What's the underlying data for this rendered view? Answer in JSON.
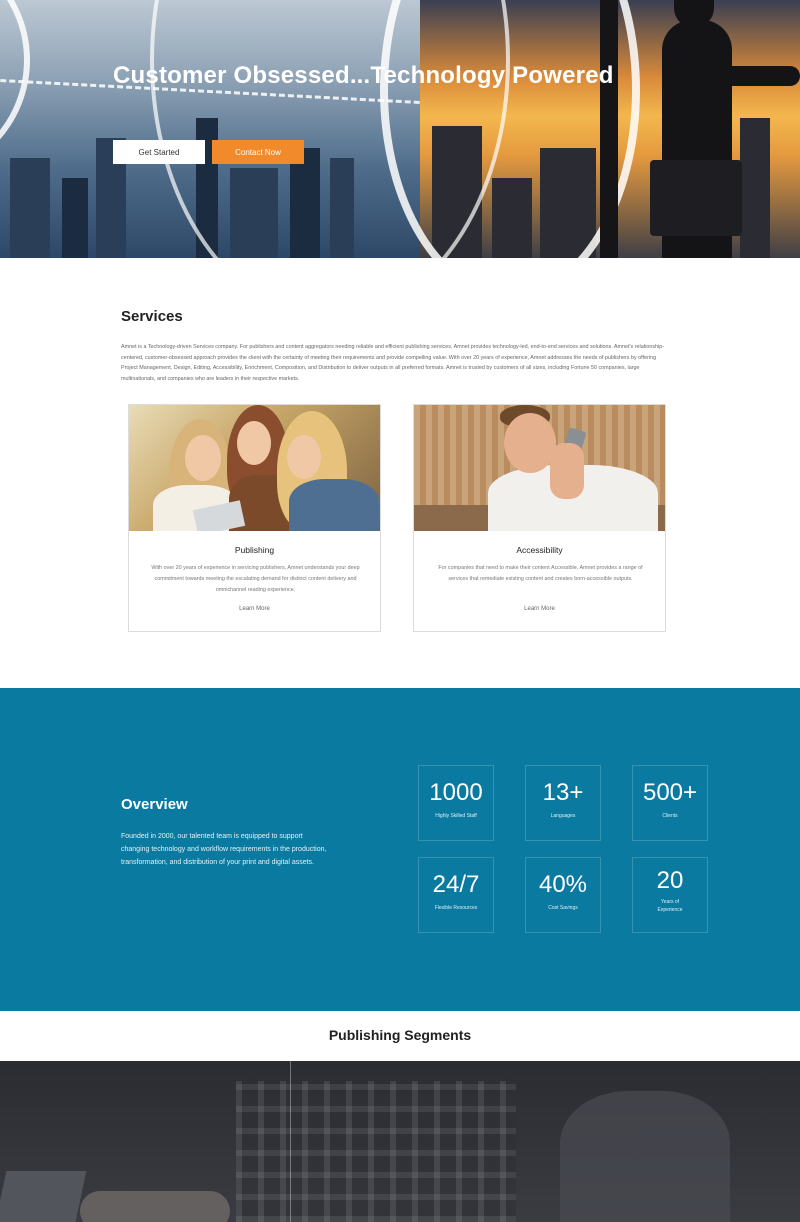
{
  "hero": {
    "title": "Customer Obsessed...Technology Powered",
    "get_started_label": "Get Started",
    "contact_label": "Contact Now"
  },
  "services": {
    "title": "Services",
    "body": "Amnet is a Technology-driven Services company. For publishers and content aggregators needing reliable and efficient publishing services, Amnet provides technology-led, end-to-end services and solutions. Amnet's relationship-centered, customer-obsessed approach provides the client with the certainty of meeting their requirements and provide compelling value. With over 20 years of experience, Amnet addresses the needs of publishers by offering Project Management, Design, Editing, Accessibility, Enrichment, Composition, and Distribution to deliver outputs in all preferred formats. Amnet is trusted by customers of all sizes, including Fortune 50 companies, large multinationals, and companies who are leaders in their respective markets.",
    "cards": [
      {
        "title": "Publishing",
        "body": "With over 20 years of experience in servicing publishers, Amnet understands your deep commitment towards meeting the escalating demand for distinct content delivery and omnichannel reading experience.",
        "link": "Learn More"
      },
      {
        "title": "Accessibility",
        "body": "For companies that need to make their content Accessible, Amnet provides a range of services that remediate existing content and creates born-accessible outputs.",
        "link": "Learn More"
      }
    ]
  },
  "overview": {
    "title": "Overview",
    "body": "Founded in 2000, our talented team is equipped to support changing technology and workflow requirements in the production, transformation, and distribution of your print and digital assets.",
    "stats": [
      {
        "value": "1000",
        "label": "Highly Skilled Staff"
      },
      {
        "value": "13+",
        "label": "Languages"
      },
      {
        "value": "500+",
        "label": "Clients"
      },
      {
        "value": "24/7",
        "label": "Flexible Resources"
      },
      {
        "value": "40%",
        "label": "Cost Savings"
      },
      {
        "value": "20",
        "label": "Years of Experience"
      }
    ]
  },
  "segments": {
    "title": "Publishing Segments"
  },
  "colors": {
    "accent_orange": "#f08a2a",
    "overview_blue": "#0b7aa0"
  }
}
